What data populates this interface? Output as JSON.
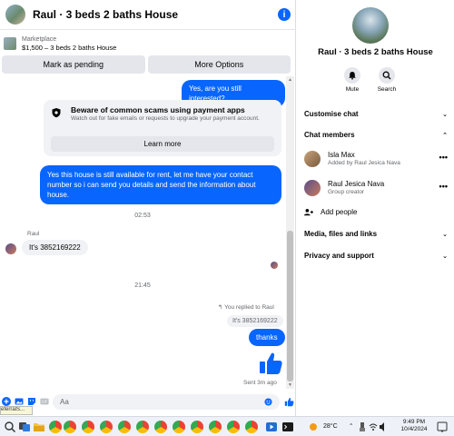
{
  "header": {
    "title": "Raul · 3 beds 2 baths House"
  },
  "marketplace": {
    "label": "Marketplace",
    "listing": "$1,500 – 3 beds 2 baths House"
  },
  "actions": {
    "mark_pending": "Mark as pending",
    "more_options": "More Options"
  },
  "messages": {
    "out1": "Yes, are you still interested?",
    "notice_title": "Beware of common scams using payment apps",
    "notice_sub": "Watch out for fake emails or requests to upgrade your payment account.",
    "learn_more": "Learn more",
    "out2": "Yes this house is still available for rent, let me have your contact number so i can send you details and send the information about house.",
    "time1": "02:53",
    "sender": "Raul",
    "in1": "It's 3852169222",
    "time2": "21:45",
    "reply_note": "You replied to Raul",
    "reply_quote": "It's 3852169222",
    "out3": "thanks",
    "sent": "Sent 3m ago"
  },
  "composer": {
    "placeholder": "Aa",
    "referral": "eferralS..."
  },
  "info": {
    "name": "Raul · 3 beds 2 baths House",
    "mute": "Mute",
    "search": "Search",
    "customise": "Customise chat",
    "members_title": "Chat members",
    "members": [
      {
        "name": "Isla Max",
        "sub": "Added by Raul Jesica Nava"
      },
      {
        "name": "Raul Jesica Nava",
        "sub": "Group creator"
      }
    ],
    "add_people": "Add people",
    "media": "Media, files and links",
    "privacy": "Privacy and support"
  },
  "taskbar": {
    "temp": "28°C",
    "time": "9:49 PM",
    "date": "10/4/2024"
  },
  "colors": {
    "accent": "#0866ff",
    "bubble_in": "#f0f2f5"
  }
}
